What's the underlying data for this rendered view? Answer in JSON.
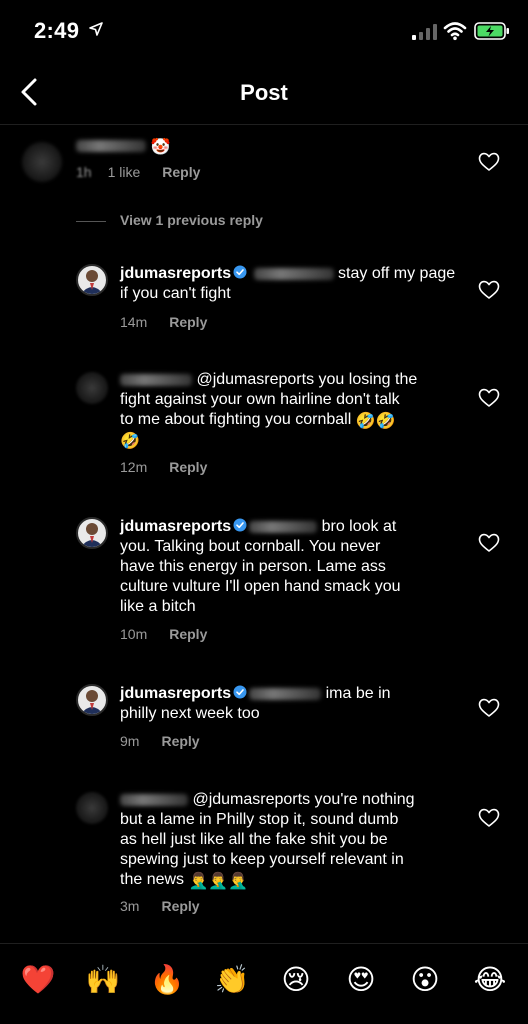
{
  "status_bar": {
    "time": "2:49"
  },
  "nav": {
    "title": "Post"
  },
  "comments": [
    {
      "likes": "1 like",
      "reply": "Reply",
      "time_prefix": "1h",
      "emoji": "🤡"
    },
    {
      "username": "jdumasreports",
      "text": "stay off my page if you can't fight",
      "time": "14m",
      "reply": "Reply"
    },
    {
      "text_line1": "@jdumasreports you losing the",
      "text_line2": "fight against your own hairline don't talk",
      "text_line3": "to me about fighting you cornball",
      "emojis": "🤣🤣",
      "emoji_line4": "🤣",
      "time": "12m",
      "reply": "Reply"
    },
    {
      "username": "jdumasreports",
      "text_line1": "bro look at",
      "text_line2": "you. Talking bout cornball. You never",
      "text_line3": "have this energy in person. Lame ass",
      "text_line4": "culture vulture I'll open hand smack you",
      "text_line5": "like a bitch",
      "time": "10m",
      "reply": "Reply"
    },
    {
      "username": "jdumasreports",
      "text_line1": "ima be in",
      "text_line2": "philly next week too",
      "time": "9m",
      "reply": "Reply"
    },
    {
      "text_line1": "@jdumasreports you're nothing",
      "text_line2": "but a lame in Philly stop it, sound dumb",
      "text_line3": "as hell just like all the fake shit you be",
      "text_line4": "spewing just to keep yourself relevant in",
      "text_line5": "the news",
      "emojis": "🤦‍♂️🤦‍♂️🤦‍♂️",
      "time": "3m",
      "reply": "Reply"
    }
  ],
  "view_previous": "View 1 previous reply",
  "reactions": [
    "❤️",
    "🙌",
    "🔥",
    "👏",
    "😢",
    "😍",
    "😮",
    "😂"
  ],
  "colors": {
    "background": "#000000",
    "secondary_text": "#9a9a9a",
    "verified": "#3897f0"
  }
}
